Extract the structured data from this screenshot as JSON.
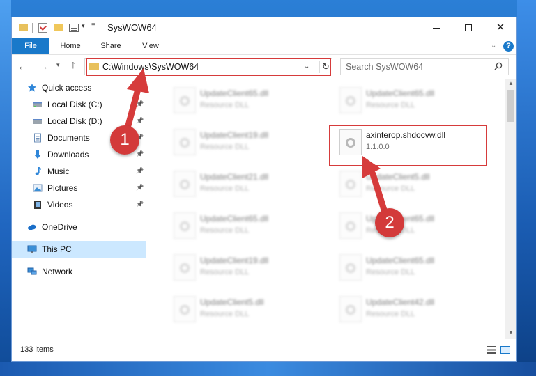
{
  "window": {
    "title": "SysWOW64"
  },
  "ribbon": {
    "tabs": [
      "File",
      "Home",
      "Share",
      "View"
    ]
  },
  "navigation": {
    "address": "C:\\Windows\\SysWOW64",
    "search_placeholder": "Search SysWOW64"
  },
  "sidebar": {
    "items": [
      {
        "label": "Quick access",
        "icon": "star-icon",
        "pinned": false
      },
      {
        "label": "Local Disk (C:)",
        "icon": "drive-icon",
        "pinned": true
      },
      {
        "label": "Local Disk (D:)",
        "icon": "drive-icon",
        "pinned": true
      },
      {
        "label": "Documents",
        "icon": "document-icon",
        "pinned": true
      },
      {
        "label": "Downloads",
        "icon": "download-arrow-icon",
        "pinned": true
      },
      {
        "label": "Music",
        "icon": "music-note-icon",
        "pinned": true
      },
      {
        "label": "Pictures",
        "icon": "picture-icon",
        "pinned": true
      },
      {
        "label": "Videos",
        "icon": "film-icon",
        "pinned": true
      },
      {
        "label": "OneDrive",
        "icon": "cloud-icon",
        "pinned": false
      },
      {
        "label": "This PC",
        "icon": "computer-icon",
        "pinned": false,
        "selected": true
      },
      {
        "label": "Network",
        "icon": "network-icon",
        "pinned": false
      }
    ]
  },
  "files": {
    "left_column": [
      {
        "name": "UpdateClient65.dll",
        "subtitle": "Resource DLL"
      },
      {
        "name": "UpdateClient19.dll",
        "subtitle": "Resource DLL"
      },
      {
        "name": "UpdateClient21.dll",
        "subtitle": "Resource DLL"
      },
      {
        "name": "UpdateClient65.dll",
        "subtitle": "Resource DLL"
      },
      {
        "name": "UpdateClient19.dll",
        "subtitle": "Resource DLL"
      },
      {
        "name": "UpdateClient5.dll",
        "subtitle": "Resource DLL"
      }
    ],
    "right_column": [
      {
        "name": "UpdateClient65.dll",
        "subtitle": "Resource DLL"
      },
      {
        "name": "axinterop.shdocvw.dll",
        "subtitle": "1.1.0.0",
        "highlighted": true
      },
      {
        "name": "UpdateClient5.dll",
        "subtitle": "Resource DLL"
      },
      {
        "name": "UpdateClient65.dll",
        "subtitle": "Resource DLL"
      },
      {
        "name": "UpdateClient65.dll",
        "subtitle": "Resource DLL"
      },
      {
        "name": "UpdateClient42.dll",
        "subtitle": "Resource DLL"
      }
    ]
  },
  "status": {
    "item_count": "133 items"
  },
  "annotations": {
    "badge_1": "1",
    "badge_2": "2",
    "color": "#d63b3b"
  }
}
